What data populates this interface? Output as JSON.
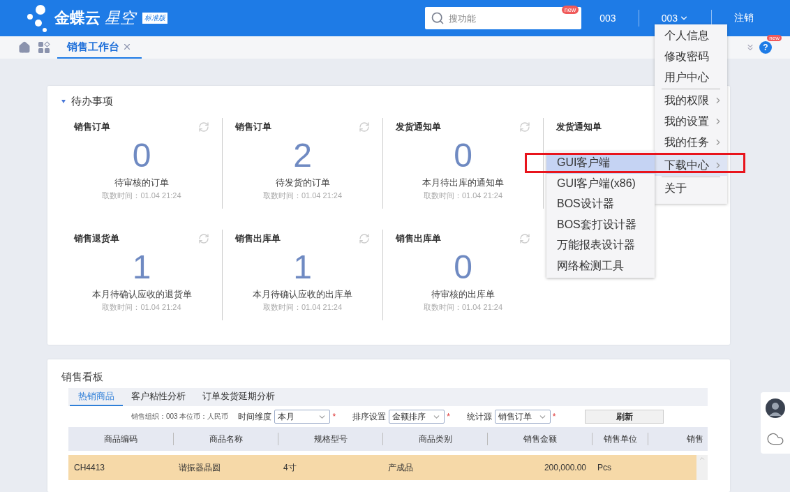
{
  "header": {
    "logo": "金蝶云",
    "product": "星空",
    "edition": "标准版",
    "search": {
      "placeholder": "搜功能",
      "badge": "new"
    },
    "org": "003",
    "user": "003",
    "logout": "注销"
  },
  "tabbar": {
    "tabs": [
      {
        "label": "销售工作台",
        "selected": true
      }
    ],
    "help": "?",
    "help_badge": "new"
  },
  "todo": {
    "title": "待办事项",
    "expanded": true,
    "items": [
      {
        "title": "销售订单",
        "count": "0",
        "desc": "待审核的订单",
        "time": "取数时间：01.04 21:24"
      },
      {
        "title": "销售订单",
        "count": "2",
        "desc": "待发货的订单",
        "time": "取数时间：01.04 21:24"
      },
      {
        "title": "发货通知单",
        "count": "0",
        "desc": "本月待出库的通知单",
        "time": "取数时间：01.04 21:24"
      },
      {
        "title": "发货通知单"
      },
      {
        "title": "销售退货单",
        "count": "1",
        "desc": "本月待确认应收的退货单",
        "time": "取数时间：01.04 21:24"
      },
      {
        "title": "销售出库单",
        "count": "1",
        "desc": "本月待确认应收的出库单",
        "time": "取数时间：01.04 21:24"
      },
      {
        "title": "销售出库单",
        "count": "0",
        "desc": "待审核的出库单",
        "time": "取数时间：01.04 21:24"
      }
    ]
  },
  "board": {
    "title": "销售看板",
    "tabs": [
      {
        "label": "热销商品",
        "selected": true
      },
      {
        "label": "客户粘性分析",
        "selected": false
      },
      {
        "label": "订单发货延期分析",
        "selected": false
      }
    ],
    "info": "销售组织：003 本位币：人民币",
    "filters": [
      {
        "label": "时间维度",
        "value": "本月",
        "required_mark": "*"
      },
      {
        "label": "排序设置",
        "value": "金额排序",
        "required_mark": "*"
      },
      {
        "label": "统计源",
        "value": "销售订单",
        "required_mark": "*"
      }
    ],
    "refresh": "刷新",
    "table": {
      "columns": [
        "商品编码",
        "商品名称",
        "规格型号",
        "商品类别",
        "销售金额",
        "销售单位",
        "销售"
      ],
      "rows": [
        {
          "selected": true,
          "cells": [
            "CH4413",
            "谐振器晶圆",
            "4寸",
            "产成品",
            "200,000.00",
            "Pcs"
          ]
        }
      ]
    }
  },
  "user_menu": {
    "groups": [
      [
        {
          "label": "个人信息",
          "kind": "item",
          "selected": false
        },
        {
          "label": "修改密码",
          "kind": "item",
          "selected": false
        },
        {
          "label": "用户中心",
          "kind": "item",
          "selected": false
        }
      ],
      [
        {
          "label": "我的权限",
          "kind": "submenu",
          "selected": false
        },
        {
          "label": "我的设置",
          "kind": "submenu",
          "selected": false
        },
        {
          "label": "我的任务",
          "kind": "submenu",
          "selected": false
        }
      ],
      [
        {
          "label": "下载中心",
          "kind": "submenu",
          "selected": true
        }
      ],
      [
        {
          "label": "关于",
          "kind": "item",
          "selected": false
        }
      ]
    ]
  },
  "download_menu": {
    "items": [
      {
        "label": "GUI客户端",
        "selected": true
      },
      {
        "label": "GUI客户端(x86)",
        "selected": false
      },
      {
        "label": "BOS设计器",
        "selected": false
      },
      {
        "label": "BOS套打设计器",
        "selected": false
      },
      {
        "label": "万能报表设计器",
        "selected": false
      },
      {
        "label": "网络检测工具",
        "selected": false
      }
    ]
  }
}
